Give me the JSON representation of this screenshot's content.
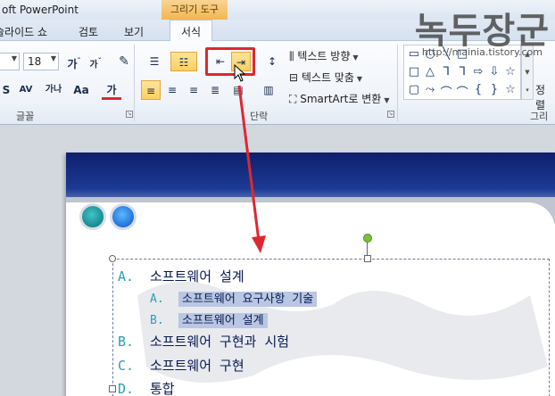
{
  "window": {
    "title": "oft PowerPoint"
  },
  "watermark": {
    "logo": "녹두장군",
    "url": "http://mainia.tistory.com"
  },
  "context_tab": {
    "label": "그리기 도구"
  },
  "tabs": [
    {
      "label": "슬라이드 쇼"
    },
    {
      "label": "검토"
    },
    {
      "label": "보기"
    },
    {
      "label": "서식",
      "active": true
    }
  ],
  "ribbon": {
    "font_group": {
      "label": "글꼴",
      "font_size": "18",
      "grow_label": "가",
      "shrink_label": "가",
      "shadow_label": "S",
      "spacing_label": "AV",
      "hangul_label": "가나",
      "case_label": "Aa",
      "color_label": "가"
    },
    "paragraph_group": {
      "label": "단락",
      "text_direction": "텍스트 방향",
      "align_text": "텍스트 맞춤",
      "smartart": "SmartArt로 변환"
    },
    "drawing_group": {
      "label": "그리기",
      "arrange": "정렬"
    }
  },
  "slide": {
    "lines": [
      {
        "marker": "A.",
        "text": "소프트웨어 설계",
        "level": 1
      },
      {
        "marker": "A.",
        "text": "소프트웨어 요구사항 기술",
        "level": 2
      },
      {
        "marker": "B.",
        "text": "소프트웨어 설계",
        "level": 2
      },
      {
        "marker": "B.",
        "text": "소프트웨어 구현과 시험",
        "level": 1
      },
      {
        "marker": "C.",
        "text": "소프트웨어 구현",
        "level": 1
      },
      {
        "marker": "D.",
        "text": "통합",
        "level": 1
      }
    ]
  },
  "colors": {
    "highlight": "#e0272f",
    "accent": "#fbcf62",
    "header": "#0e1f6d"
  }
}
